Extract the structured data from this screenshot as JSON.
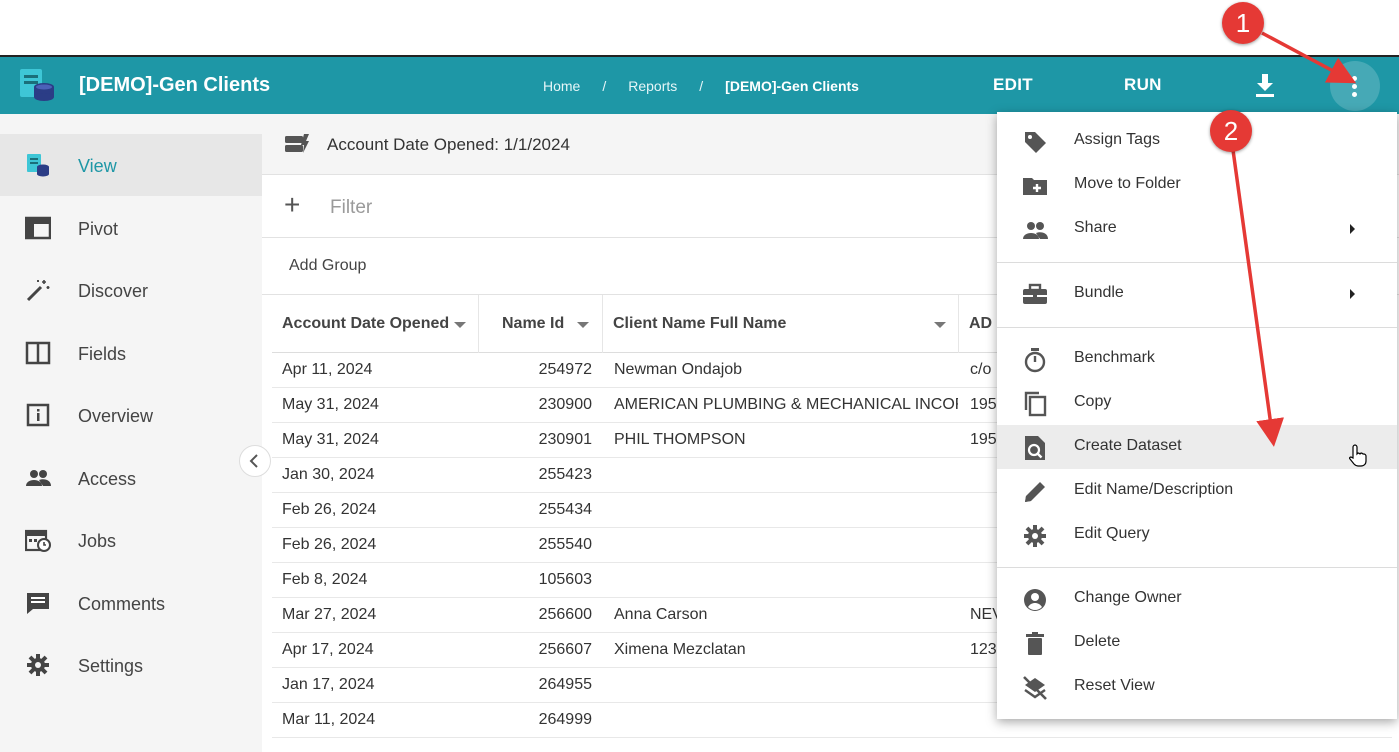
{
  "app": {
    "title": "[DEMO]-Gen Clients",
    "breadcrumbs": [
      "Home",
      "Reports",
      "[DEMO]-Gen Clients"
    ],
    "breadcrumb_sep": "/",
    "actions": {
      "edit": "EDIT",
      "run": "RUN"
    },
    "colors": {
      "bar": "#1e97a6",
      "accent": "#1e97a6",
      "annotation": "#e53935"
    }
  },
  "sidebar": {
    "items": [
      {
        "label": "View",
        "icon": "view-icon",
        "active": true
      },
      {
        "label": "Pivot",
        "icon": "pivot-icon"
      },
      {
        "label": "Discover",
        "icon": "magic-wand-icon"
      },
      {
        "label": "Fields",
        "icon": "columns-icon"
      },
      {
        "label": "Overview",
        "icon": "info-icon"
      },
      {
        "label": "Access",
        "icon": "people-icon"
      },
      {
        "label": "Jobs",
        "icon": "calendar-clock-icon"
      },
      {
        "label": "Comments",
        "icon": "comment-icon"
      },
      {
        "label": "Settings",
        "icon": "gear-icon"
      }
    ]
  },
  "main": {
    "criteria": "Account Date Opened: 1/1/2024",
    "filter_placeholder": "Filter",
    "add_group": "Add Group",
    "table": {
      "headers": [
        "Account Date Opened",
        "Name Id",
        "Client Name Full Name",
        "AD"
      ],
      "rows": [
        [
          "Apr 11, 2024",
          "254972",
          "Newman Ondajob",
          "c/o"
        ],
        [
          "May 31, 2024",
          "230900",
          "AMERICAN PLUMBING & MECHANICAL INCORP",
          "195"
        ],
        [
          "May 31, 2024",
          "230901",
          "PHIL THOMPSON",
          "195"
        ],
        [
          "Jan 30, 2024",
          "255423",
          "",
          ""
        ],
        [
          "Feb 26, 2024",
          "255434",
          "",
          ""
        ],
        [
          "Feb 26, 2024",
          "255540",
          "",
          ""
        ],
        [
          "Feb 8, 2024",
          "105603",
          "",
          ""
        ],
        [
          "Mar 27, 2024",
          "256600",
          "Anna Carson",
          "NEV"
        ],
        [
          "Apr 17, 2024",
          "256607",
          "Ximena Mezclatan",
          "123"
        ],
        [
          "Jan 17, 2024",
          "264955",
          "",
          ""
        ],
        [
          "Mar 11, 2024",
          "264999",
          "",
          ""
        ]
      ]
    }
  },
  "menu": {
    "groups": [
      [
        {
          "label": "Assign Tags",
          "icon": "tag-icon"
        },
        {
          "label": "Move to Folder",
          "icon": "folder-plus-icon"
        },
        {
          "label": "Share",
          "icon": "people-icon",
          "submenu": true
        }
      ],
      [
        {
          "label": "Bundle",
          "icon": "briefcase-icon",
          "submenu": true
        }
      ],
      [
        {
          "label": "Benchmark",
          "icon": "stopwatch-icon"
        },
        {
          "label": "Copy",
          "icon": "copy-icon"
        },
        {
          "label": "Create Dataset",
          "icon": "dataset-search-icon",
          "hover": true
        },
        {
          "label": "Edit Name/Description",
          "icon": "pencil-icon"
        },
        {
          "label": "Edit Query",
          "icon": "gear-icon"
        }
      ],
      [
        {
          "label": "Change Owner",
          "icon": "account-circle-icon"
        },
        {
          "label": "Delete",
          "icon": "trash-icon"
        },
        {
          "label": "Reset View",
          "icon": "layers-off-icon"
        }
      ]
    ]
  },
  "annotations": {
    "step1": "1",
    "step2": "2"
  }
}
